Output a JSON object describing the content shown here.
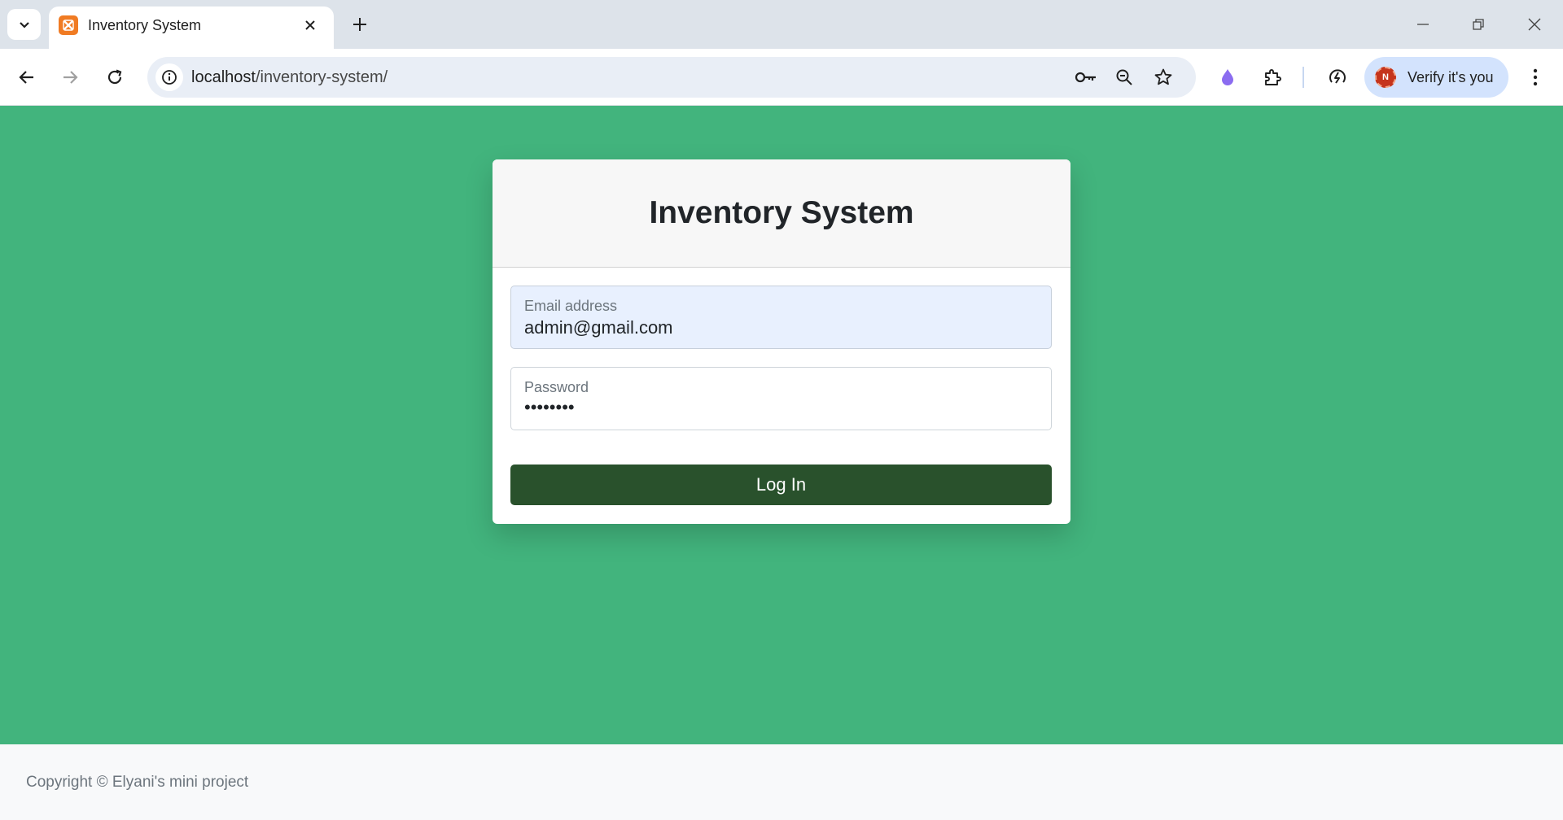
{
  "browser": {
    "tab": {
      "title": "Inventory System"
    },
    "address_bar": {
      "host": "localhost",
      "path": "/inventory-system/"
    },
    "profile": {
      "label": "Verify it's you",
      "initial": "N"
    },
    "icons": {
      "tab_list": "chevron-down-icon",
      "favicon": "xampp-icon",
      "tab_close": "close-icon",
      "new_tab": "plus-icon",
      "back": "arrow-left-icon",
      "forward": "arrow-right-icon",
      "reload": "reload-icon",
      "site_info": "info-icon",
      "passwords": "key-icon",
      "zoom": "zoom-out-icon",
      "bookmark": "star-icon",
      "extension_drop": "droplet-icon",
      "extensions": "puzzle-icon",
      "performance": "speed-icon",
      "menu": "kebab-menu-icon"
    }
  },
  "login": {
    "title": "Inventory System",
    "email": {
      "label": "Email address",
      "value": "admin@gmail.com"
    },
    "password": {
      "label": "Password",
      "value": "••••••••"
    },
    "submit_label": "Log In"
  },
  "footer": {
    "text": "Copyright © Elyani's mini project"
  },
  "colors": {
    "page_background": "#42b47d",
    "button_background": "#29512c",
    "autofill_background": "#e8f0fe",
    "footer_background": "#f8f9fa"
  }
}
